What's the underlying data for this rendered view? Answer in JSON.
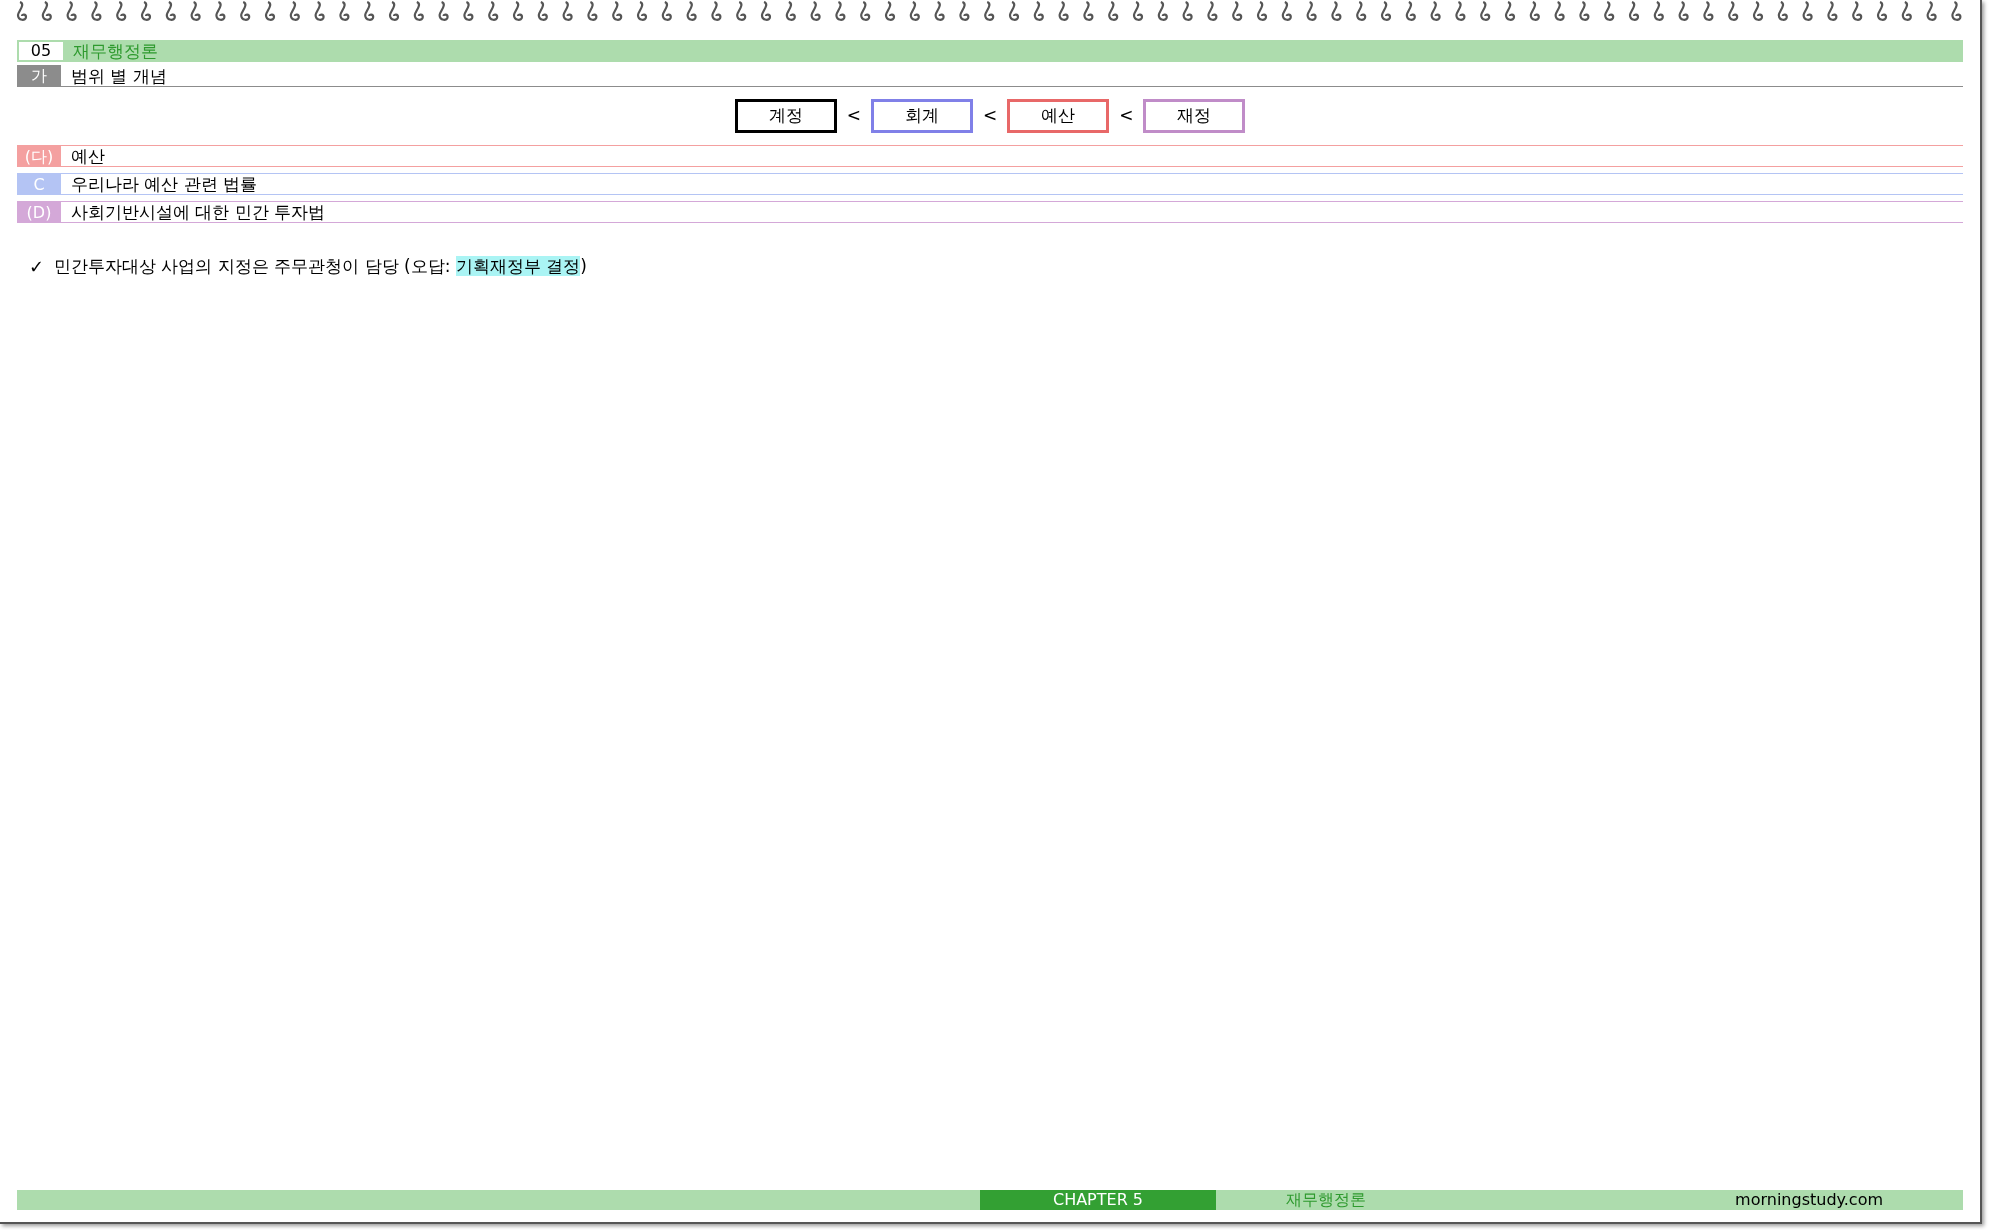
{
  "chapter": {
    "number": "05",
    "title": "재무행정론"
  },
  "section": {
    "marker": "가",
    "title": "범위 별 개념",
    "color": "#8c8c8c"
  },
  "hierarchy": [
    {
      "label": "계정",
      "color": "#000000",
      "separator": "<"
    },
    {
      "label": "회계",
      "color": "#8080e8",
      "separator": "<"
    },
    {
      "label": "예산",
      "color": "#e86868",
      "separator": "<"
    },
    {
      "label": "재정",
      "color": "#c08cc8"
    }
  ],
  "subsections": [
    {
      "marker": "(다)",
      "title": "예산",
      "color": "#f4a0a0"
    },
    {
      "marker": "C",
      "title": "우리나라 예산 관련 법률",
      "color": "#b4c4f4"
    },
    {
      "marker": "(D)",
      "title": "사회기반시설에 대한 민간 투자법",
      "color": "#d4a8d8"
    }
  ],
  "notes": [
    {
      "mark": "✓",
      "text": "민간투자대상 사업의 지정은 주무관청이 담당 (오답: ",
      "highlight": "기획재정부 결정",
      "tail": ")"
    }
  ],
  "footer": {
    "chapter": "CHAPTER 5",
    "title": "재무행정론",
    "site": "morningstudy.com"
  }
}
